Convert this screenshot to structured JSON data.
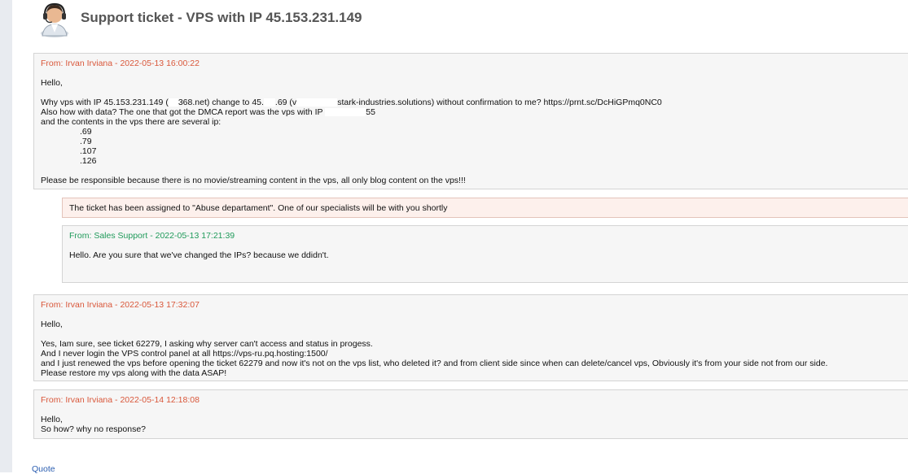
{
  "ticket": {
    "title": "Support ticket - VPS with IP 45.153.231.149"
  },
  "messages": [
    {
      "from": "From: Irvan Irviana - 2022-05-13 16:00:22",
      "greeting": "Hello,",
      "line1a": "Why vps with IP 45.153.231.149 (",
      "line1b": "368.net) change to 45.",
      "line1c": ".69 (v",
      "line1d": "stark-industries.solutions) without confirmation to me? https://prnt.sc/DcHiGPmq0NC0",
      "line2a": "Also how with data? The one that got the DMCA report was the vps with IP",
      "line2b": "55",
      "line3": "and the contents in the vps there are several ip:",
      "ips": [
        ".69",
        ".79",
        ".107",
        ".126"
      ],
      "closing": "Please be responsible because there is no movie/streaming content in the vps, all only blog content on the vps!!!"
    },
    {
      "from": "From: Sales Support - 2022-05-13 17:21:39",
      "body": "Hello. Are you sure that we've changed the IPs? because we ddidn't."
    },
    {
      "from": "From: Irvan Irviana - 2022-05-13 17:32:07",
      "greeting": "Hello,",
      "lines": [
        "Yes, Iam sure, see ticket 62279, I asking why server can't access and status in progess.",
        "And I never login the VPS control panel at all https://vps-ru.pq.hosting:1500/",
        "and I just renewed the vps before opening the ticket 62279 and now it's not on the vps list, who deleted it? and from client side since when can delete/cancel vps, Obviously it's from your side not from our side.",
        "Please restore my vps along with the data ASAP!"
      ]
    },
    {
      "from": "From: Irvan Irviana - 2022-05-14 12:18:08",
      "lines": [
        "Hello,",
        "So how? why no response?"
      ]
    }
  ],
  "notice": "The ticket has been assigned to \"Abuse departament\". One of our specialists will be with you shortly",
  "footer": {
    "quote_label": "Quote"
  },
  "colors": {
    "client": "#d9573a",
    "staff": "#1f9a5a",
    "link": "#2a5db0"
  }
}
